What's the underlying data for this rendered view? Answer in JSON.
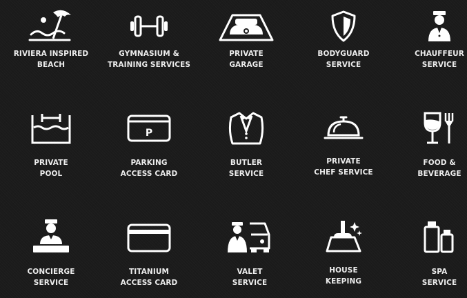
{
  "amenities": [
    {
      "icon": "beach-umbrella-icon",
      "line1": "RIVIERA INSPIRED",
      "line2": "BEACH"
    },
    {
      "icon": "dumbbell-icon",
      "line1": "GYMNASIUM &",
      "line2": "TRAINING SERVICES"
    },
    {
      "icon": "sports-car-garage-icon",
      "line1": "PRIVATE",
      "line2": "GARAGE"
    },
    {
      "icon": "shield-icon",
      "line1": "BODYGUARD",
      "line2": "SERVICE"
    },
    {
      "icon": "chauffeur-icon",
      "line1": "CHAUFFEUR",
      "line2": "SERVICE"
    },
    {
      "icon": "pool-icon",
      "line1": "PRIVATE",
      "line2": "POOL"
    },
    {
      "icon": "parking-card-icon",
      "line1": "PARKING",
      "line2": "ACCESS CARD"
    },
    {
      "icon": "tuxedo-icon",
      "line1": "BUTLER",
      "line2": "SERVICE"
    },
    {
      "icon": "cloche-icon",
      "line1": "PRIVATE",
      "line2": "CHEF SERVICE"
    },
    {
      "icon": "wine-glass-cutlery-icon",
      "line1": "FOOD &",
      "line2": "BEVERAGE"
    },
    {
      "icon": "concierge-icon",
      "line1": "CONCIERGE",
      "line2": "SERVICE"
    },
    {
      "icon": "access-card-icon",
      "line1": "TITANIUM",
      "line2": "ACCESS CARD"
    },
    {
      "icon": "valet-car-icon",
      "line1": "VALET",
      "line2": "SERVICE"
    },
    {
      "icon": "dustpan-sparkle-icon",
      "line1": "HOUSE",
      "line2": "KEEPING"
    },
    {
      "icon": "spa-bottles-icon",
      "line1": "SPA",
      "line2": "SERVICE"
    }
  ],
  "colors": {
    "background": "#1b1b1b",
    "icon": "#ffffff",
    "label": "#ececec"
  }
}
